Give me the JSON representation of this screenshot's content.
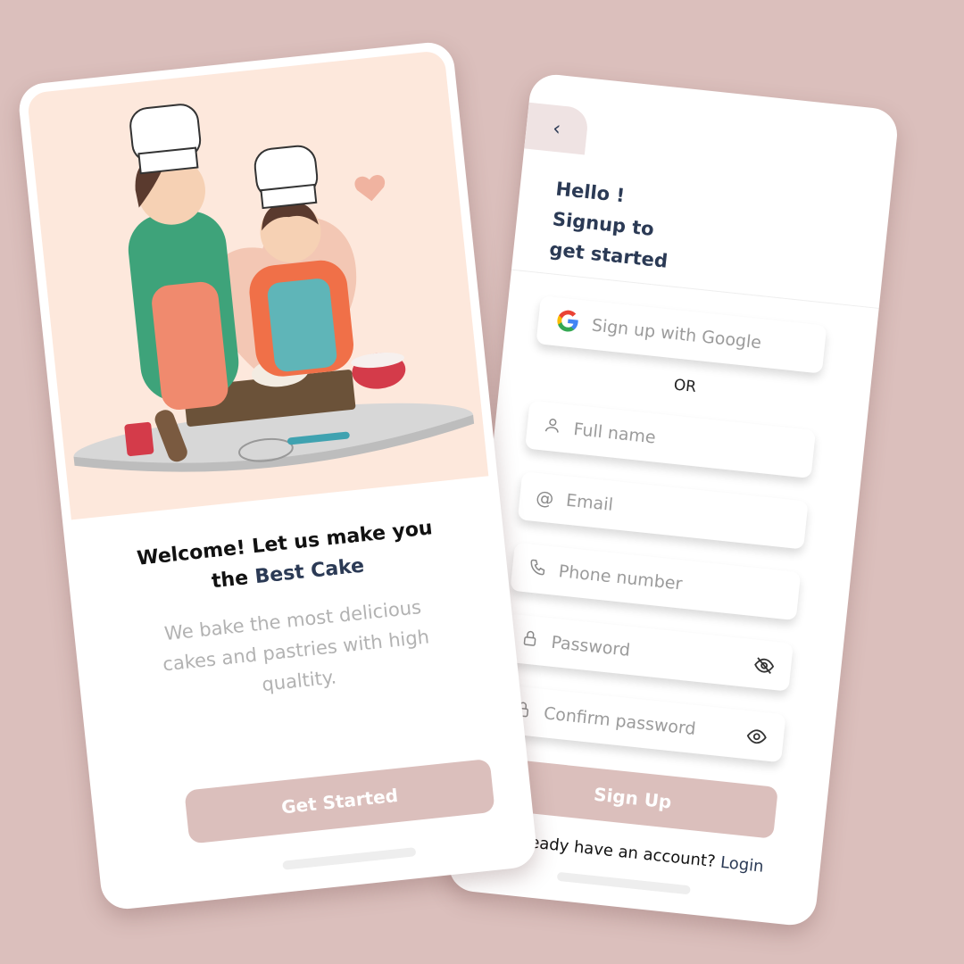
{
  "colors": {
    "background": "#dbbfbc",
    "accent": "#2b3a55",
    "button": "#dbbfbc",
    "muted_text": "#b2b2b2"
  },
  "welcome": {
    "heading_line1": "Welcome! Let us make you",
    "heading_line2_prefix": "the",
    "heading_accent": "Best Cake",
    "subtitle": "We bake the most delicious cakes and pastries with high qualtity.",
    "cta_label": "Get Started",
    "illustration": "two-chefs-baking-illustration"
  },
  "signup": {
    "back_icon": "chevron-left-icon",
    "greeting_line1": "Hello !",
    "greeting_line2": "Signup to",
    "greeting_line3": "get started",
    "google_label": "Sign up with Google",
    "or_label": "OR",
    "fields": [
      {
        "placeholder": "Full name",
        "icon": "user-icon"
      },
      {
        "placeholder": "Email",
        "icon": "at-icon"
      },
      {
        "placeholder": "Phone number",
        "icon": "phone-icon"
      },
      {
        "placeholder": "Password",
        "icon": "lock-icon",
        "trailing_icon": "eye-off-icon"
      },
      {
        "placeholder": "Confirm password",
        "icon": "lock-icon",
        "trailing_icon": "eye-icon"
      }
    ],
    "submit_label": "Sign Up",
    "login_prompt": "Already have an account?",
    "login_link": "Login"
  }
}
